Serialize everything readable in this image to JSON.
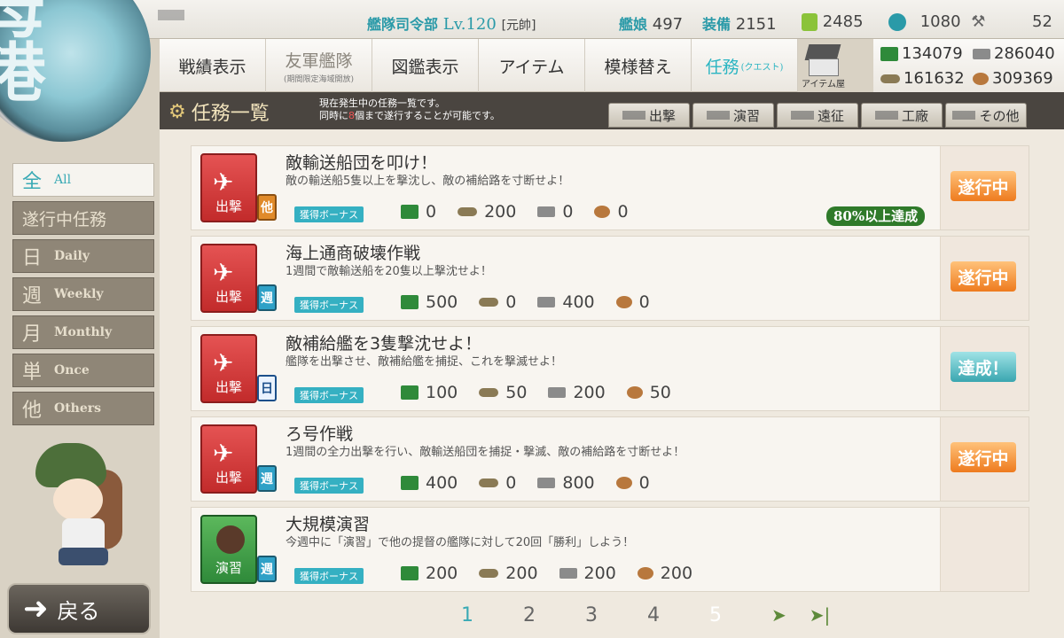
{
  "status": {
    "hq_label": "艦隊司令部",
    "level": "Lv.120",
    "rank": "[元帥]",
    "ships_label": "艦娘",
    "ships": "497",
    "equip_label": "装備",
    "equip": "2151",
    "buckets": "2485",
    "dev_tools": "1080",
    "screws": "52"
  },
  "nav": [
    {
      "label": "戦績表示"
    },
    {
      "label": "友軍艦隊",
      "sub": "(期間限定海域開放)"
    },
    {
      "label": "図鑑表示"
    },
    {
      "label": "アイテム"
    },
    {
      "label": "模様替え"
    },
    {
      "label": "任務",
      "sub": "(クエスト)"
    }
  ],
  "item_shop_label": "アイテム屋",
  "resources": {
    "fuel": "134079",
    "ammo": "286040",
    "steel": "161632",
    "bauxite": "309369"
  },
  "header": {
    "title": "任務一覧",
    "desc1": "現在発生中の任務一覧です。",
    "desc2_a": "同時に",
    "desc2_num": "8",
    "desc2_b": "個まで遂行することが可能です。"
  },
  "filters": [
    "出撃",
    "演習",
    "遠征",
    "工廠",
    "その他"
  ],
  "sidebar": [
    {
      "k": "全",
      "e": "All",
      "active": true
    },
    {
      "k": "遂行中任務",
      "e": ""
    },
    {
      "k": "日",
      "e": "Daily"
    },
    {
      "k": "週",
      "e": "Weekly"
    },
    {
      "k": "月",
      "e": "Monthly"
    },
    {
      "k": "単",
      "e": "Once"
    },
    {
      "k": "他",
      "e": "Others"
    }
  ],
  "back_label": "戻る",
  "bonus_label": "獲得ボーナス",
  "quests": [
    {
      "icon_label": "出撃",
      "tag": "他",
      "title": "敵輸送船団を叩け！",
      "desc": "敵の輸送船5隻以上を撃沈し、敵の補給路を寸断せよ！",
      "fuel": "0",
      "ammo": "200",
      "steel": "0",
      "baux": "0",
      "status": "遂行中",
      "progress": "80%以上達成"
    },
    {
      "icon_label": "出撃",
      "tag": "週",
      "title": "海上通商破壊作戦",
      "desc": "1週間で敵輸送船を20隻以上撃沈せよ！",
      "fuel": "500",
      "ammo": "0",
      "steel": "400",
      "baux": "0",
      "status": "遂行中"
    },
    {
      "icon_label": "出撃",
      "tag": "日",
      "title": "敵補給艦を3隻撃沈せよ！",
      "desc": "艦隊を出撃させ、敵補給艦を捕捉、これを撃滅せよ！",
      "fuel": "100",
      "ammo": "50",
      "steel": "200",
      "baux": "50",
      "status": "達成！"
    },
    {
      "icon_label": "出撃",
      "tag": "週",
      "title": "ろ号作戦",
      "desc": "1週間の全力出撃を行い、敵輸送船団を捕捉・撃滅、敵の補給路を寸断せよ！",
      "fuel": "400",
      "ammo": "0",
      "steel": "800",
      "baux": "0",
      "status": "遂行中"
    },
    {
      "icon_label": "演習",
      "tag": "週",
      "title": "大規模演習",
      "desc": "今週中に「演習」で他の提督の艦隊に対して20回「勝利」しよう！",
      "fuel": "200",
      "ammo": "200",
      "steel": "200",
      "baux": "200",
      "status": ""
    }
  ],
  "pager": [
    "1",
    "2",
    "3",
    "4",
    "5"
  ],
  "colors": {
    "accent": "#3aaab5",
    "progress": "#ee7b1e",
    "done": "#3aa6b0"
  }
}
